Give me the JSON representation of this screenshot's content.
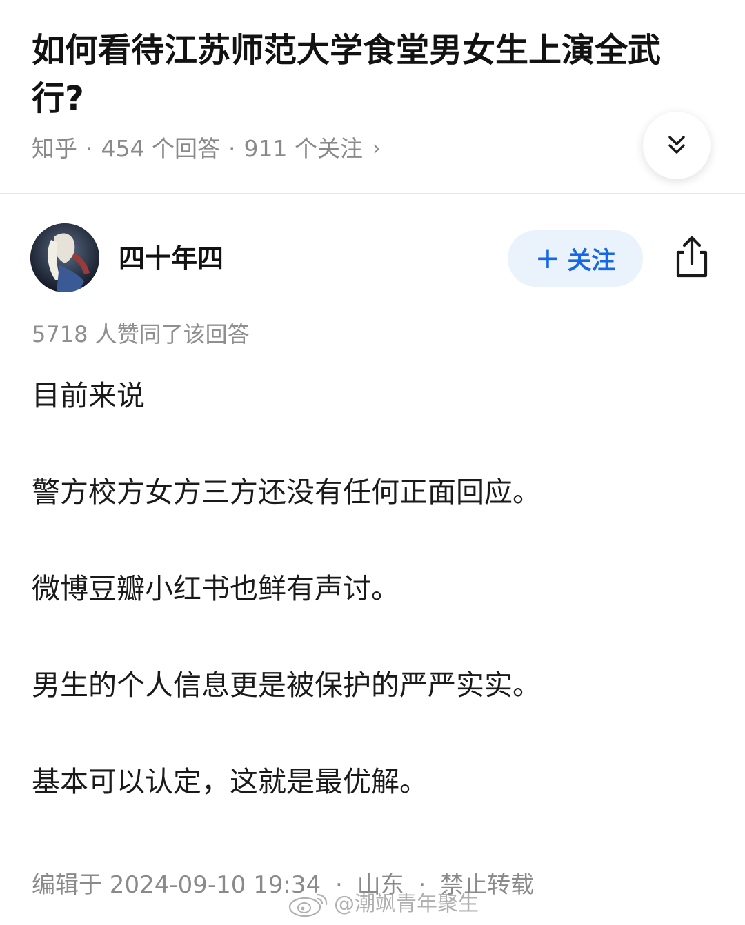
{
  "question": {
    "title": "如何看待江苏师范大学食堂男女生上演全武行?",
    "source": "知乎",
    "answers_count": "454 个回答",
    "followers_count": "911 个关注"
  },
  "author": {
    "name": "四十年四",
    "follow_label": "关注"
  },
  "answer": {
    "vote_text": "5718 人赞同了该回答",
    "paragraphs": [
      "目前来说",
      "警方校方女方三方还没有任何正面回应。",
      "微博豆瓣小红书也鲜有声讨。",
      "男生的个人信息更是被保护的严严实实。",
      "基本可以认定，这就是最优解。"
    ],
    "edited": "编辑于 2024-09-10 19:34",
    "location": "山东",
    "rights": "禁止转载"
  },
  "watermark": "@潮飒青年聚生",
  "colors": {
    "accent": "#1768e6",
    "follow_bg": "#eaf2fb",
    "meta_gray": "#8a8a8a"
  },
  "icons": {
    "expand": "double-chevron-down-icon",
    "share": "share-icon",
    "meta_arrow": "chevron-right-icon"
  }
}
